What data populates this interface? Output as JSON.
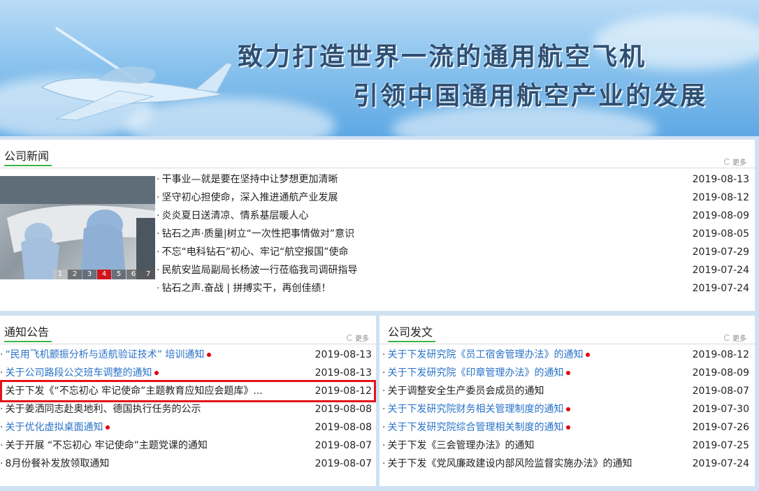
{
  "banner": {
    "slogan_line1": "致力打造世界一流的通用航空飞机",
    "slogan_line2": "引领中国通用航空产业的发展"
  },
  "company_news": {
    "title": "公司新闻",
    "more": "更多",
    "pager": [
      "1",
      "2",
      "3",
      "4",
      "5",
      "6",
      "7"
    ],
    "pager_active": "4",
    "items": [
      {
        "title": "干事业—就是要在坚持中让梦想更加清晰",
        "date": "2019-08-13"
      },
      {
        "title": "坚守初心担使命，深入推进通航产业发展",
        "date": "2019-08-12"
      },
      {
        "title": "炎炎夏日送清凉、情系基层暖人心",
        "date": "2019-08-09"
      },
      {
        "title": "钻石之声·质量|树立“一次性把事情做对”意识",
        "date": "2019-08-05"
      },
      {
        "title": "不忘“电科钻石”初心、牢记“航空报国”使命",
        "date": "2019-07-29"
      },
      {
        "title": "民航安监局副局长杨波一行莅临我司调研指导",
        "date": "2019-07-24"
      },
      {
        "title": "钻石之声.奋战 | 拼搏实干，再创佳绩！",
        "date": "2019-07-24"
      }
    ]
  },
  "notices": {
    "title": "通知公告",
    "more": "更多",
    "items": [
      {
        "title": "“民用飞机颤振分析与适航验证技术” 培训通知",
        "date": "2019-08-13",
        "new": true
      },
      {
        "title": "关于公司路段公交班车调整的通知",
        "date": "2019-08-13",
        "new": true
      },
      {
        "title": "关于下发《“不忘初心 牢记使命”主题教育应知应会题库》...",
        "date": "2019-08-12",
        "new": false
      },
      {
        "title": "关于姜洒同志赴奥地利、德国执行任务的公示",
        "date": "2019-08-08",
        "new": false
      },
      {
        "title": "关于优化虚拟桌面通知",
        "date": "2019-08-08",
        "new": true
      },
      {
        "title": "关于开展 “不忘初心 牢记使命”主题党课的通知",
        "date": "2019-08-07",
        "new": false
      },
      {
        "title": "8月份餐补发放领取通知",
        "date": "2019-08-07",
        "new": false
      }
    ]
  },
  "company_docs": {
    "title": "公司发文",
    "more": "更多",
    "items": [
      {
        "title": "关于下发研究院《员工宿舍管理办法》的通知",
        "date": "2019-08-12",
        "new": true
      },
      {
        "title": "关于下发研究院《印章管理办法》的通知",
        "date": "2019-08-09",
        "new": true
      },
      {
        "title": "关于调整安全生产委员会成员的通知",
        "date": "2019-08-07",
        "new": false
      },
      {
        "title": "关于下发研究院财务相关管理制度的通知",
        "date": "2019-07-30",
        "new": true
      },
      {
        "title": "关于下发研究院综合管理相关制度的通知",
        "date": "2019-07-26",
        "new": true
      },
      {
        "title": "关于下发《三会管理办法》的通知",
        "date": "2019-07-25",
        "new": false
      },
      {
        "title": "关于下发《党风廉政建设内部风险监督实施办法》的通知",
        "date": "2019-07-24",
        "new": false
      }
    ]
  },
  "colors": {
    "accent_green": "#3bb54a",
    "link_blue": "#2a73c8",
    "new_dot_red": "#e0000a",
    "highlight_red": "#e3141a"
  }
}
